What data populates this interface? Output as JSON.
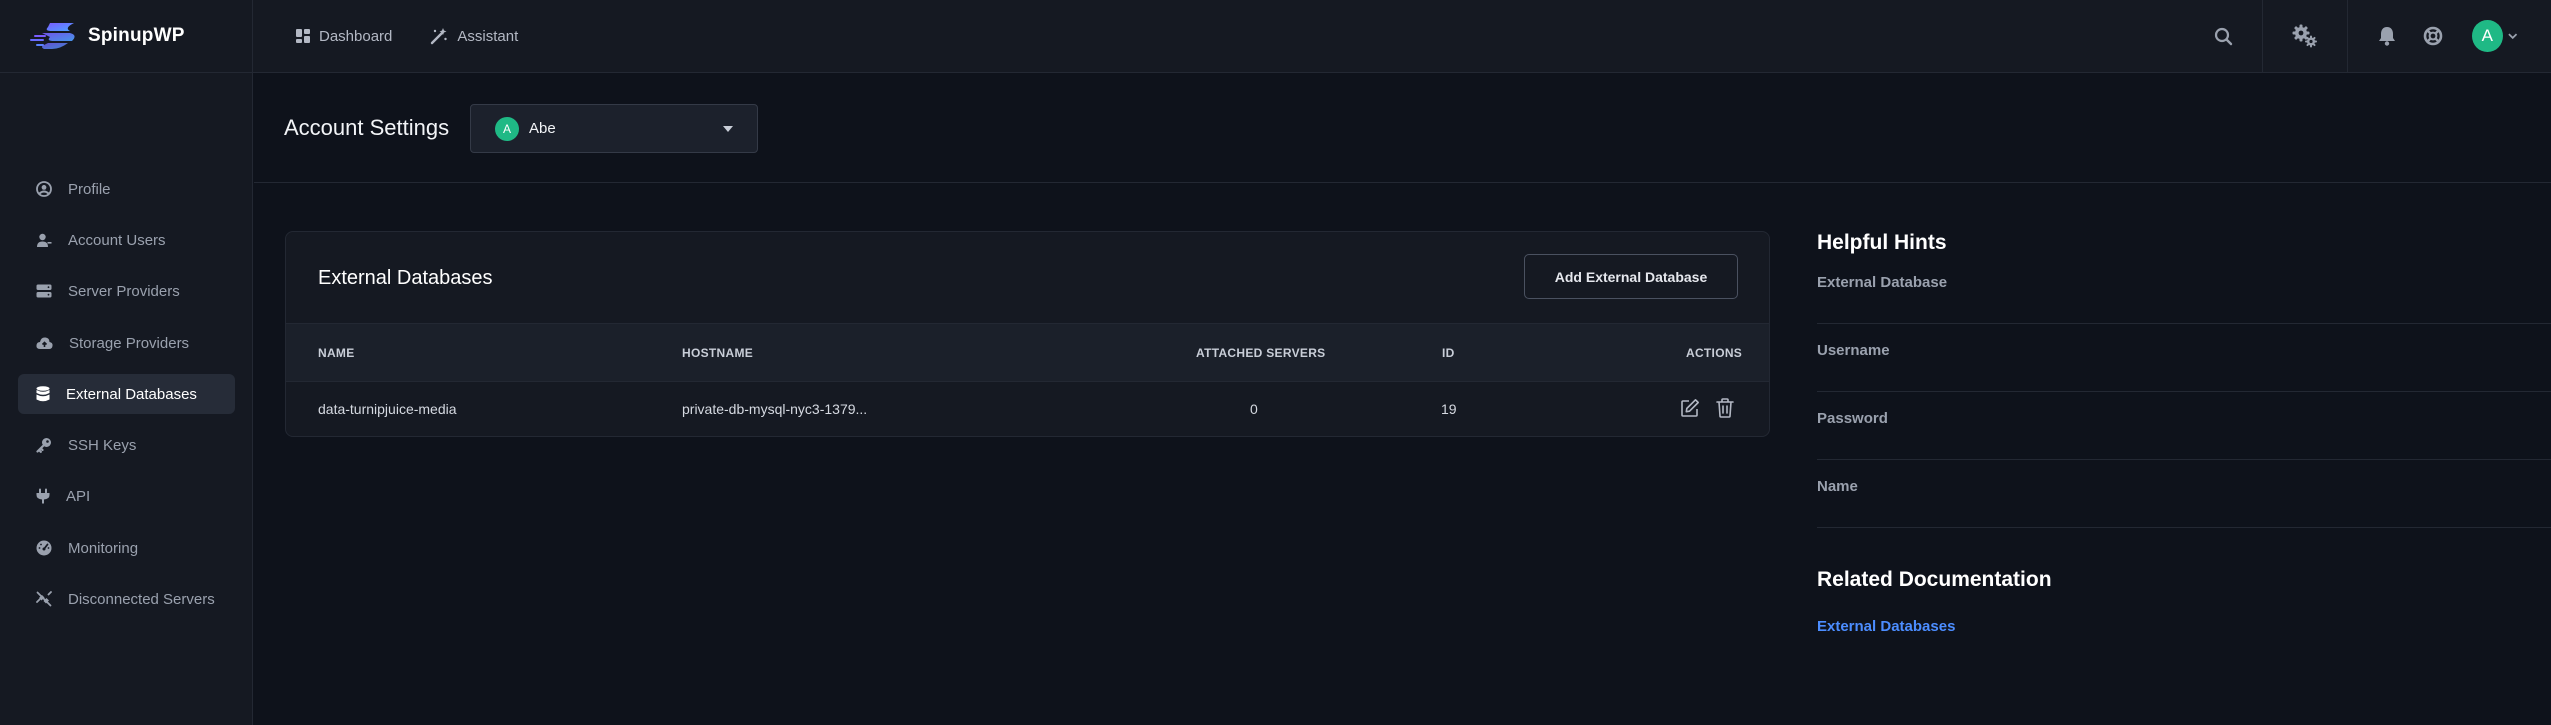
{
  "brand": {
    "name": "SpinupWP"
  },
  "topnav": [
    {
      "label": "Dashboard",
      "icon": "dashboard-icon"
    },
    {
      "label": "Assistant",
      "icon": "wand-icon"
    }
  ],
  "user": {
    "initial": "A"
  },
  "sidebar": {
    "items": [
      {
        "label": "Profile",
        "icon": "user-circle-icon"
      },
      {
        "label": "Account Users",
        "icon": "user-icon"
      },
      {
        "label": "Server Providers",
        "icon": "server-icon"
      },
      {
        "label": "Storage Providers",
        "icon": "cloud-upload-icon"
      },
      {
        "label": "External Databases",
        "icon": "database-icon",
        "active": true
      },
      {
        "label": "SSH Keys",
        "icon": "key-icon"
      },
      {
        "label": "API",
        "icon": "plug-icon"
      },
      {
        "label": "Monitoring",
        "icon": "gauge-icon"
      },
      {
        "label": "Disconnected Servers",
        "icon": "disconnect-icon"
      }
    ]
  },
  "header": {
    "title": "Account Settings",
    "account": {
      "initial": "A",
      "name": "Abe"
    }
  },
  "card": {
    "title": "External Databases",
    "add_label": "Add External Database",
    "columns": {
      "name": "NAME",
      "hostname": "HOSTNAME",
      "attached": "ATTACHED SERVERS",
      "id": "ID",
      "actions": "ACTIONS"
    },
    "rows": [
      {
        "name": "data-turnipjuice-media",
        "hostname": "private-db-mysql-nyc3-1379...",
        "attached": "0",
        "id": "19"
      }
    ]
  },
  "hints": {
    "title": "Helpful Hints",
    "items": [
      "External Database",
      "Username",
      "Password",
      "Name"
    ]
  },
  "docs": {
    "title": "Related Documentation",
    "links": [
      "External Databases"
    ]
  },
  "colors": {
    "background": "#0e121b",
    "panel": "#151922",
    "accent_green": "#1fb985",
    "link_blue": "#4c8dff"
  }
}
